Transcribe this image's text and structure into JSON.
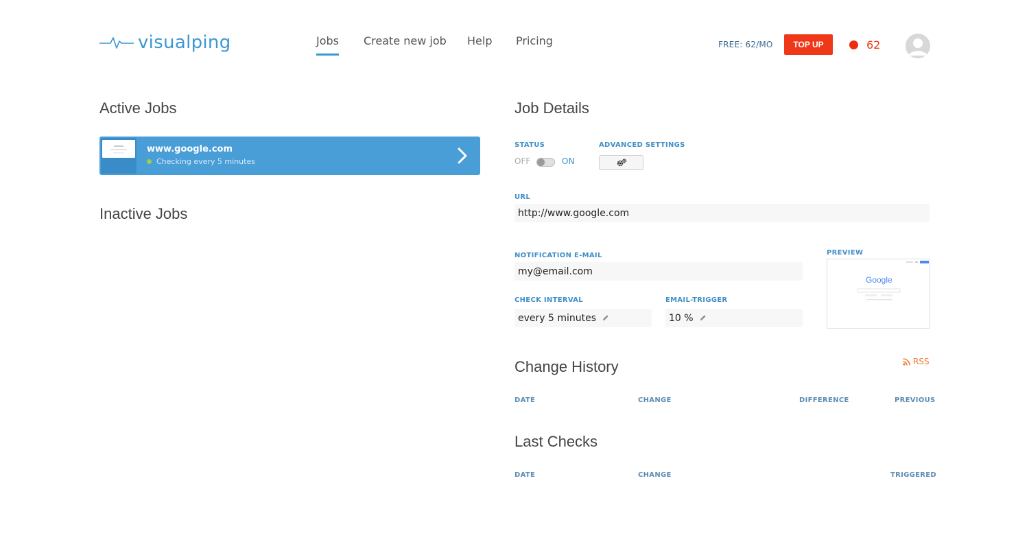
{
  "header": {
    "brand": "visualping",
    "nav": [
      {
        "label": "Jobs",
        "active": true
      },
      {
        "label": "Create new job",
        "active": false
      },
      {
        "label": "Help",
        "active": false
      },
      {
        "label": "Pricing",
        "active": false
      }
    ],
    "plan_label": "FREE: 62/MO",
    "topup_label": "TOP UP",
    "credits": "62",
    "avatar_icon": "user-avatar-icon"
  },
  "left": {
    "active_title": "Active Jobs",
    "active_jobs": [
      {
        "url": "www.google.com",
        "status": "Checking every 5 minutes"
      }
    ],
    "inactive_title": "Inactive Jobs"
  },
  "details": {
    "title": "Job Details",
    "status_label": "STATUS",
    "off": "OFF",
    "on": "ON",
    "advanced_label": "ADVANCED SETTINGS",
    "url_label": "URL",
    "url_value": "http://www.google.com",
    "email_label": "NOTIFICATION E-MAIL",
    "email_value": "my@email.com",
    "interval_label": "CHECK INTERVAL",
    "interval_value": "every 5 minutes",
    "trigger_label": "EMAIL-TRIGGER",
    "trigger_value": "10 %",
    "preview_label": "PREVIEW",
    "preview_logo": "Google"
  },
  "history": {
    "title": "Change History",
    "rss": "RSS",
    "columns": [
      "DATE",
      "CHANGE",
      "DIFFERENCE",
      "PREVIOUS"
    ]
  },
  "checks": {
    "title": "Last Checks",
    "columns": [
      "DATE",
      "CHANGE",
      "TRIGGERED"
    ]
  },
  "colors": {
    "brand": "#3c97d3",
    "topup": "#ef3817",
    "card": "#4a9ed8",
    "label": "#3f8fc6",
    "rss": "#f07a36"
  }
}
